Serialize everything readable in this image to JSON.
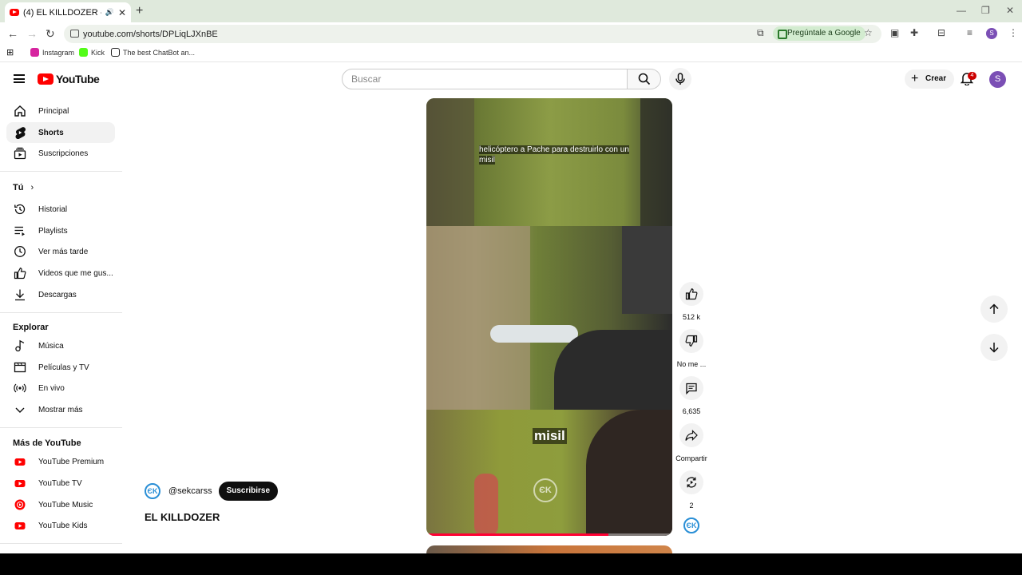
{
  "browser": {
    "tab_title": "(4) EL KILLDOZER - YouTube",
    "url": "youtube.com/shorts/DPLiqLJXnBE",
    "ask_google": "Pregúntale a Google",
    "profile_initial": "S",
    "bookmarks": [
      {
        "label": "Instagram",
        "color": "#d6249f"
      },
      {
        "label": "Kick",
        "color": "#53fc18"
      },
      {
        "label": "The best ChatBot an...",
        "color": "#222222"
      }
    ]
  },
  "masthead": {
    "logo_text": "YouTube",
    "search_placeholder": "Buscar",
    "create_label": "Crear",
    "notification_count": "4",
    "avatar_initial": "S"
  },
  "sidebar": {
    "main": [
      {
        "label": "Principal",
        "icon": "home-icon"
      },
      {
        "label": "Shorts",
        "icon": "shorts-icon",
        "active": true
      },
      {
        "label": "Suscripciones",
        "icon": "subscriptions-icon"
      }
    ],
    "you_heading": "Tú",
    "you": [
      {
        "label": "Historial",
        "icon": "history-icon"
      },
      {
        "label": "Playlists",
        "icon": "playlists-icon"
      },
      {
        "label": "Ver más tarde",
        "icon": "watch-later-icon"
      },
      {
        "label": "Videos que me gus...",
        "icon": "like-icon"
      },
      {
        "label": "Descargas",
        "icon": "download-icon"
      }
    ],
    "explore_heading": "Explorar",
    "explore": [
      {
        "label": "Música",
        "icon": "music-icon"
      },
      {
        "label": "Películas y TV",
        "icon": "movies-icon"
      },
      {
        "label": "En vivo",
        "icon": "live-icon"
      },
      {
        "label": "Mostrar más",
        "icon": "chevron-down-icon"
      }
    ],
    "more_heading": "Más de YouTube",
    "more": [
      {
        "label": "YouTube Premium",
        "icon": "youtube-premium-icon"
      },
      {
        "label": "YouTube TV",
        "icon": "youtube-tv-icon"
      },
      {
        "label": "YouTube Music",
        "icon": "youtube-music-icon"
      },
      {
        "label": "YouTube Kids",
        "icon": "youtube-kids-icon"
      }
    ]
  },
  "short": {
    "caption_top": "helicóptero a Pache para destruirlo con un misil",
    "caption_bottom": "misil",
    "progress": 0.74,
    "channel_handle": "@sekcarss",
    "channel_logo_text": "ЄK",
    "subscribe_label": "Suscribirse",
    "title": "EL KILLDOZER"
  },
  "actions": {
    "likes": "512 k",
    "dislike_label": "No me ...",
    "comments": "6,635",
    "share_label": "Compartir",
    "remix_count": "2"
  },
  "colors": {
    "brand_red": "#ff0000",
    "accent_purple": "#7b4fb5",
    "badge_red": "#cc0000"
  }
}
